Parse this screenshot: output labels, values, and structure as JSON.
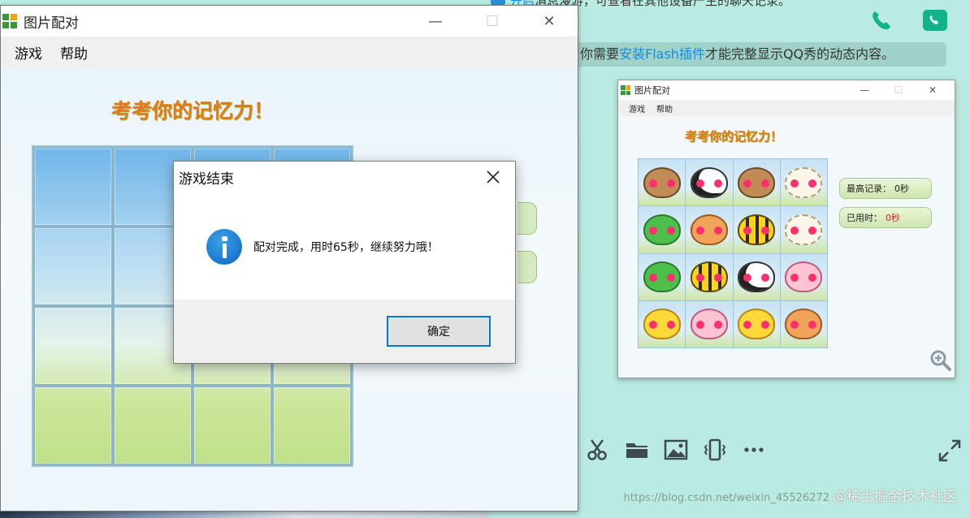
{
  "background_chat": {
    "top_notice_prefix": "开启",
    "top_notice_rest": "消息漫游，可查看在其他设备产生的聊天记录。",
    "flash_notice_prefix": "你需要",
    "flash_notice_link": "安装Flash插件",
    "flash_notice_suffix": "才能完整显示QQ秀的动态内容。",
    "toolbar_icons": [
      "scissors-icon",
      "folder-icon",
      "image-icon",
      "shake-icon",
      "more-icon"
    ],
    "watermark_url": "https://blog.csdn.net/weixin_45526272",
    "watermark_brand": "@稀土掘金技术社区"
  },
  "game_window": {
    "title": "图片配对",
    "menu": [
      "游戏",
      "帮助"
    ],
    "heading": "考考你的记忆力！"
  },
  "dialog": {
    "title": "游戏结束",
    "message": "配对完成，用时65秒，继续努力哦！",
    "ok_label": "确定"
  },
  "thumbnail": {
    "title": "图片配对",
    "menu": [
      "游戏",
      "帮助"
    ],
    "heading": "考考你的记忆力！",
    "board": [
      [
        "dog",
        "cow",
        "dog",
        "sheep"
      ],
      [
        "frog",
        "cat",
        "bee",
        "sheep"
      ],
      [
        "frog",
        "bee",
        "cow",
        "pig"
      ],
      [
        "chick",
        "pig",
        "chick",
        "cat"
      ]
    ],
    "best_record_label": "最高记录：",
    "best_record_value": "0秒",
    "elapsed_label": "已用时：",
    "elapsed_value": "0秒"
  },
  "colors": {
    "chat_bg": "#b9ebe3",
    "heading_orange": "#e07a1a",
    "dialog_accent": "#0078d7",
    "link_blue": "#0a8ee8",
    "elapsed_red": "#e0182a"
  }
}
